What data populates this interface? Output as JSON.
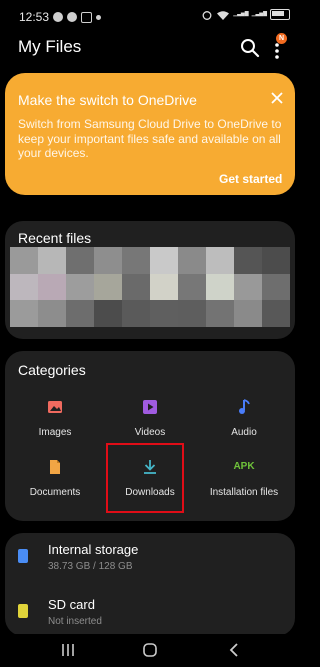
{
  "status": {
    "time": "12:53"
  },
  "header": {
    "title": "My Files",
    "badge": "N"
  },
  "promo": {
    "title": "Make the switch to OneDrive",
    "body": "Switch from Samsung Cloud Drive to OneDrive to keep your important files safe and available on all your devices.",
    "cta": "Get started",
    "color": "#f7ab32"
  },
  "recent": {
    "title": "Recent files",
    "thumbnail_colors": [
      "#9a9a9a",
      "#b7b7b7",
      "#6f6f6f",
      "#8e8e8e",
      "#777777",
      "#c9c9c9",
      "#8a8a8a",
      "#bdbdbd",
      "#555555",
      "#4c4c4c",
      "#bdb7bd",
      "#b9a9b5",
      "#9d9d9d",
      "#a6a69b",
      "#6a6a6a",
      "#d2d2c8",
      "#777777",
      "#cfd3c9",
      "#999999",
      "#6e6e6e",
      "#9b9b9b",
      "#8d8d8d",
      "#6d6d6d",
      "#4c4c4c",
      "#5a5a5a",
      "#5f5f5f",
      "#5e5e5e",
      "#737373",
      "#8a8a8a",
      "#585858"
    ]
  },
  "categories": {
    "title": "Categories",
    "items": [
      {
        "label": "Images",
        "icon": "image-icon",
        "color": "#f06a5f"
      },
      {
        "label": "Videos",
        "icon": "video-icon",
        "color": "#a05be0"
      },
      {
        "label": "Audio",
        "icon": "music-note-icon",
        "color": "#4a7dfa"
      },
      {
        "label": "Documents",
        "icon": "document-icon",
        "color": "#f2a544"
      },
      {
        "label": "Downloads",
        "icon": "download-icon",
        "color": "#45b6c8"
      },
      {
        "label": "Installation files",
        "icon": "apk-icon",
        "icon_text": "APK",
        "color": "#6fc23a"
      }
    ]
  },
  "storage": {
    "items": [
      {
        "title": "Internal storage",
        "sub": "38.73 GB / 128 GB",
        "color": "#4a8df5"
      },
      {
        "title": "SD card",
        "sub": "Not inserted",
        "color": "#e0d43a"
      }
    ]
  }
}
